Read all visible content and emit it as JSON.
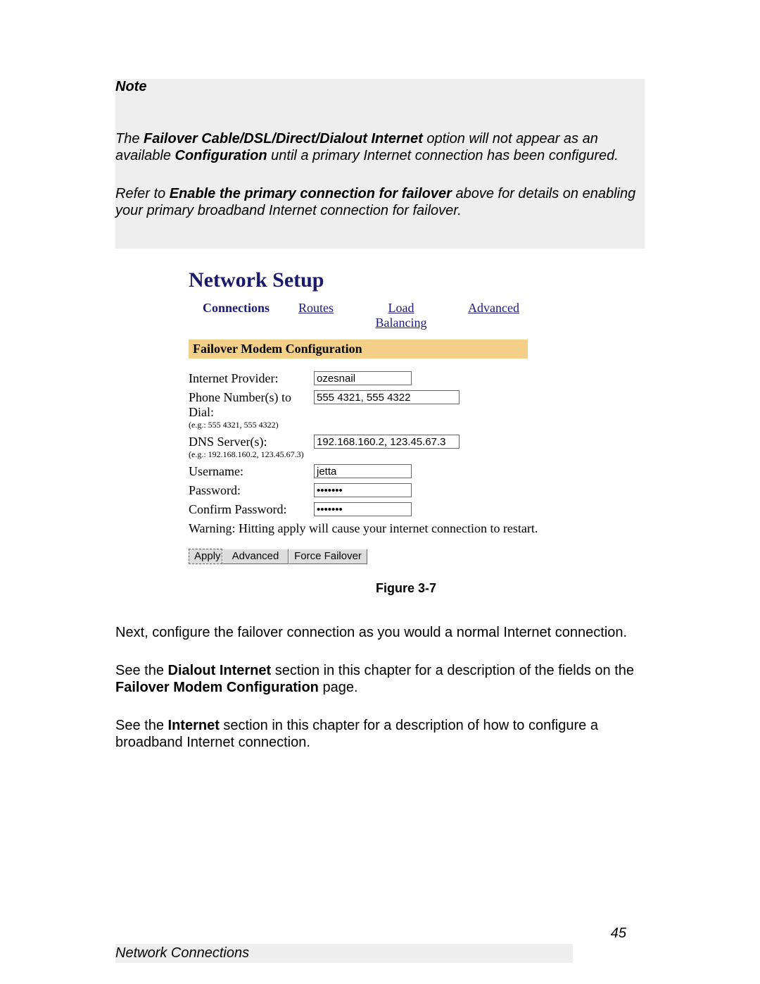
{
  "note": {
    "label": "Note",
    "p1_prefix": "The ",
    "p1_bold": "Failover Cable/DSL/Direct/Dialout Internet",
    "p1_mid": " option will not appear as an available ",
    "p1_bold2": "Configuration",
    "p1_end": " until a primary Internet connection has been configured.",
    "p2_prefix": "Refer to ",
    "p2_bold": "Enable the primary connection for failover",
    "p2_end": " above for details on enabling your primary broadband Internet connection for failover."
  },
  "figure": {
    "title": "Network Setup",
    "tabs": {
      "connections": "Connections",
      "routes": "Routes",
      "load_balancing": "Load Balancing",
      "advanced": "Advanced"
    },
    "section_title": "Failover Modem Configuration",
    "fields": {
      "provider_label": "Internet Provider:",
      "provider_value": "ozesnail",
      "phone_label": "Phone Number(s) to Dial:",
      "phone_hint": "(e.g.: 555 4321, 555 4322)",
      "phone_value": "555 4321, 555 4322",
      "dns_label": "DNS Server(s):",
      "dns_hint": "(e.g.: 192.168.160.2, 123.45.67.3)",
      "dns_value": "192.168.160.2, 123.45.67.3",
      "username_label": "Username:",
      "username_value": "jetta",
      "password_label": "Password:",
      "password_value": "•••••••",
      "confirm_label": "Confirm Password:",
      "confirm_value": "•••••••"
    },
    "warning": "Warning: Hitting apply will cause your internet connection to restart.",
    "buttons": {
      "apply": "Apply",
      "advanced": "Advanced",
      "force": "Force Failover"
    },
    "caption": "Figure 3-7"
  },
  "body": {
    "p1": "Next, configure the failover connection as you would a normal Internet connection.",
    "p2_a": "See the ",
    "p2_b": "Dialout Internet",
    "p2_c": " section in this chapter for a description of the fields on the ",
    "p2_d": "Failover Modem Configuration",
    "p2_e": " page.",
    "p3_a": "See the ",
    "p3_b": "Internet",
    "p3_c": " section in this chapter for a description of how to configure a broadband Internet connection."
  },
  "footer": {
    "title": "Network Connections",
    "page": "45"
  }
}
